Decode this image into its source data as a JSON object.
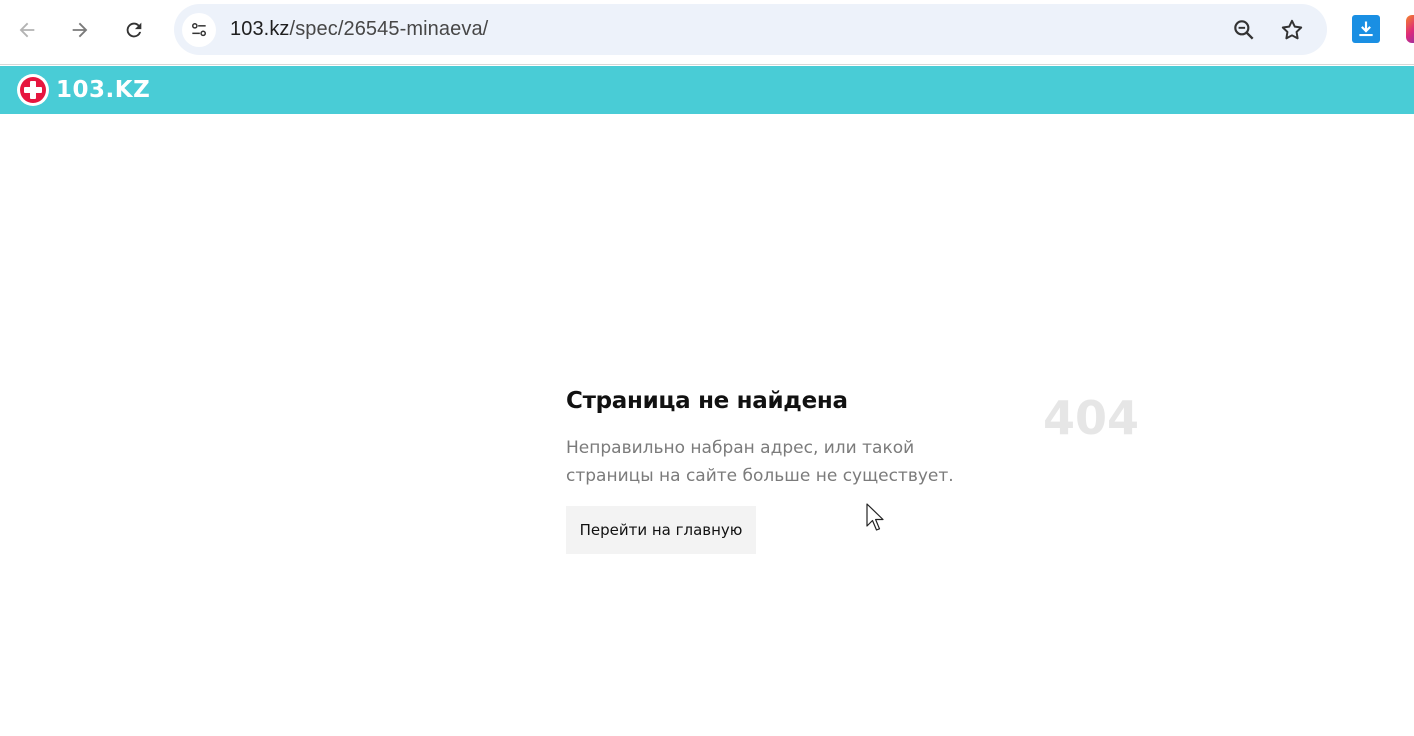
{
  "browser": {
    "url_host": "103.kz",
    "url_path": "/spec/26545-minaeva/",
    "icons": [
      "back-arrow-icon",
      "forward-arrow-icon",
      "reload-icon",
      "site-settings-icon",
      "zoom-out-icon",
      "bookmark-star-icon",
      "download-extension-icon",
      "instagram-extension-icon"
    ]
  },
  "site": {
    "logo_text": "103.KZ",
    "header_color": "#49ccd6",
    "logo_accent": "#e6163f"
  },
  "error": {
    "title": "Страница не найдена",
    "code": "404",
    "description": "Неправильно набран адрес, или такой страницы на сайте больше не существует.",
    "home_button": "Перейти на главную"
  }
}
